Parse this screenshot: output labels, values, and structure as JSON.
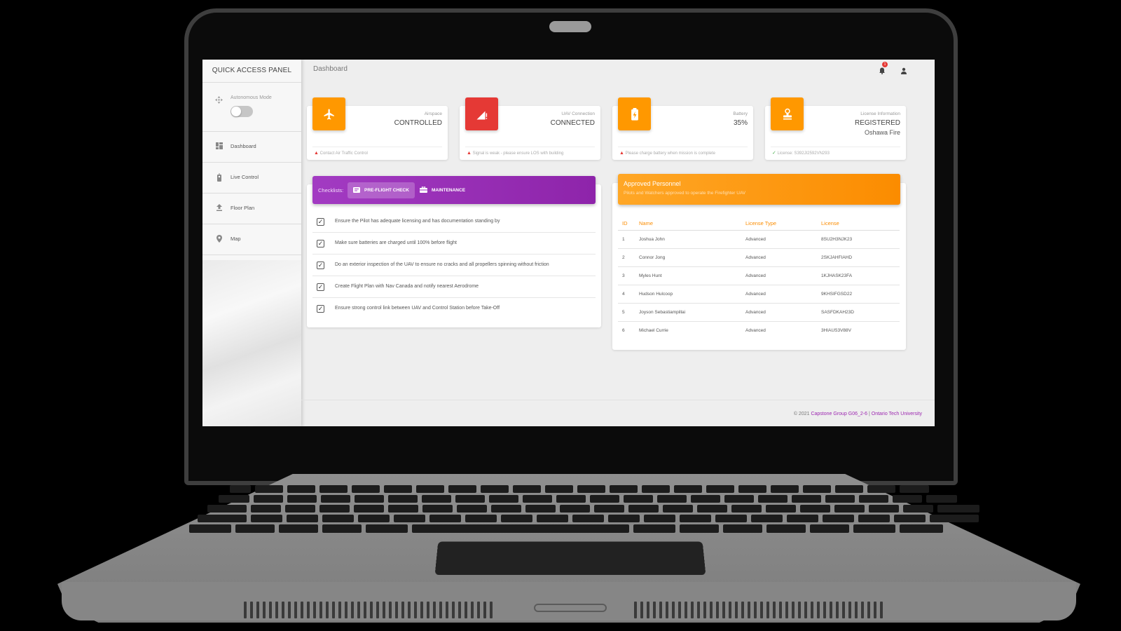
{
  "sidebar": {
    "title": "QUICK ACCESS PANEL",
    "autonomous_mode": {
      "label": "Autonomous Mode",
      "enabled": false
    },
    "items": [
      {
        "label": "Dashboard",
        "icon": "dashboard-icon"
      },
      {
        "label": "Live Control",
        "icon": "remote-icon"
      },
      {
        "label": "Floor Plan",
        "icon": "upload-icon"
      },
      {
        "label": "Map",
        "icon": "map-pin-icon"
      }
    ]
  },
  "header": {
    "title": "Dashboard",
    "notification_count": "1"
  },
  "stats": [
    {
      "label": "Airspace",
      "value": "CONTROLLED",
      "value2": "",
      "footer": "Contact Air Traffic Control",
      "status": "warning",
      "icon": "airplane-icon",
      "color": "#ff9800"
    },
    {
      "label": "UAV Connection",
      "value": "CONNECTED",
      "value2": "",
      "footer": "Signal is weak - please ensure LOS with building",
      "status": "warning",
      "icon": "signal-icon",
      "color": "#e53935"
    },
    {
      "label": "Battery",
      "value": "35%",
      "value2": "",
      "footer": "Please charge battery when mission is complete",
      "status": "warning",
      "icon": "battery-icon",
      "color": "#ff9800"
    },
    {
      "label": "License Information",
      "value": "REGISTERED",
      "value2": "Oshawa Fire",
      "footer": "License: S392JI2592VN293",
      "status": "ok",
      "icon": "stamp-icon",
      "color": "#ff9800"
    }
  ],
  "checklist": {
    "label": "Checklists:",
    "tabs": [
      {
        "label": "PRE-FLIGHT CHECK",
        "icon": "checklist-icon"
      },
      {
        "label": "MAINTENANCE",
        "icon": "toolbox-icon"
      }
    ],
    "items": [
      {
        "text": "Ensure the Pilot has adequate licensing and has documentation standing by",
        "checked": true
      },
      {
        "text": "Make sure batteries are charged until 100% before flight",
        "checked": true
      },
      {
        "text": "Do an exterior inspection of the UAV to ensure no cracks and all propellers spinning without friction",
        "checked": true
      },
      {
        "text": "Create Flight Plan with Nav Canada and notify nearest Aerodrome",
        "checked": true
      },
      {
        "text": "Ensure strong control link between UAV and Control Station before Take-Off",
        "checked": true
      }
    ]
  },
  "personnel": {
    "title": "Approved Personnel",
    "subtitle": "Pilots and Watchers approved to operate the Firefighter UAV",
    "columns": [
      "ID",
      "Name",
      "License Type",
      "License"
    ],
    "rows": [
      {
        "id": "1",
        "name": "Joshua John",
        "type": "Advanced",
        "license": "8SU2H3NJK23"
      },
      {
        "id": "2",
        "name": "Connor Jong",
        "type": "Advanced",
        "license": "2SKJAHFIAHD"
      },
      {
        "id": "3",
        "name": "Myles Hunt",
        "type": "Advanced",
        "license": "1KJHASK23FA"
      },
      {
        "id": "4",
        "name": "Hudson Hulcoop",
        "type": "Advanced",
        "license": "9KHSIFGSD22"
      },
      {
        "id": "5",
        "name": "Joyson Sebastiampillai",
        "type": "Advanced",
        "license": "SASFDKAH23D"
      },
      {
        "id": "6",
        "name": "Michael Currie",
        "type": "Advanced",
        "license": "3HIAUS3V88V"
      }
    ]
  },
  "footer": {
    "prefix": "© 2021",
    "group": "Capstone Group G06_2-6",
    "separator": "|",
    "university": "Ontario Tech University"
  }
}
